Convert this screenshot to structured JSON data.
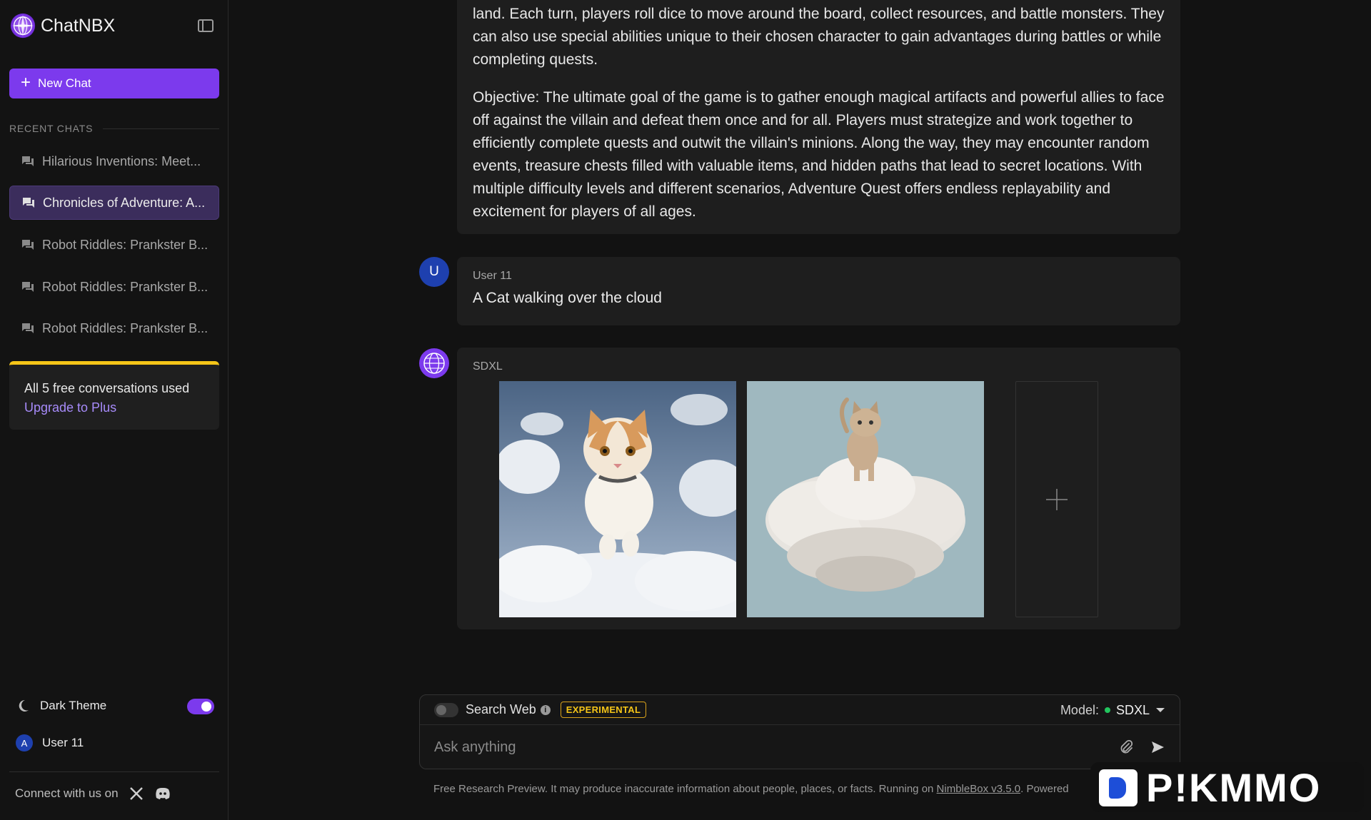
{
  "app": {
    "name": "ChatNBX"
  },
  "sidebar": {
    "new_chat_label": "New Chat",
    "recent_label": "RECENT CHATS",
    "chats": [
      {
        "title": "Hilarious Inventions: Meet...",
        "active": false
      },
      {
        "title": "Chronicles of Adventure: A...",
        "active": true
      },
      {
        "title": "Robot Riddles: Prankster B...",
        "active": false
      },
      {
        "title": "Robot Riddles: Prankster B...",
        "active": false
      },
      {
        "title": "Robot Riddles: Prankster B...",
        "active": false
      }
    ],
    "quota_text": "All 5 free conversations used",
    "upgrade_label": "Upgrade to Plus",
    "theme_label": "Dark Theme",
    "theme_on": true,
    "user_initial": "A",
    "user_name": "User 11",
    "connect_label": "Connect with us on"
  },
  "messages": {
    "assistant_text_1": "land. Each turn, players roll dice to move around the board, collect resources, and battle monsters. They can also use special abilities unique to their chosen character to gain advantages during battles or while completing quests.",
    "assistant_text_2": "Objective: The ultimate goal of the game is to gather enough magical artifacts and powerful allies to face off against the villain and defeat them once and for all. Players must strategize and work together to efficiently complete quests and outwit the villain's minions. Along the way, they may encounter random events, treasure chests filled with valuable items, and hidden paths that lead to secret locations. With multiple difficulty levels and different scenarios, Adventure Quest offers endless replayability and excitement for players of all ages.",
    "user_initial": "U",
    "user_sender": "User 11",
    "user_text": "A Cat walking over the cloud",
    "bot_sender": "SDXL"
  },
  "composer": {
    "search_web_label": "Search Web",
    "info_glyph": "i",
    "experimental_badge": "EXPERIMENTAL",
    "model_label": "Model:",
    "model_value": "SDXL",
    "placeholder": "Ask anything"
  },
  "footer": {
    "text_before": "Free Research Preview. It may produce inaccurate information about people, places, or facts. Running on ",
    "link": "NimbleBox v3.5.0",
    "text_after": ". Powered"
  },
  "watermark": {
    "text": "P!KMMO"
  },
  "colors": {
    "accent": "#7c3aed",
    "warning": "#f5c518",
    "online": "#22c55e",
    "avatar": "#1e40af"
  }
}
